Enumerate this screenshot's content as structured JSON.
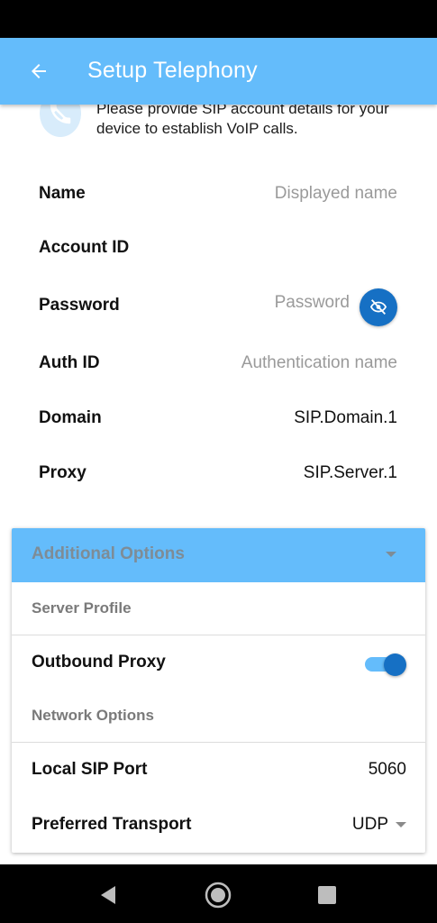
{
  "app_bar": {
    "title": "Setup Telephony",
    "back_icon": "arrow-left-icon"
  },
  "intro": {
    "icon": "phone-disabled-icon",
    "text": "Please provide SIP account details for your device to establish VoIP calls."
  },
  "fields": {
    "name": {
      "label": "Name",
      "placeholder": "Displayed name"
    },
    "account_id": {
      "label": "Account ID",
      "value": ""
    },
    "password": {
      "label": "Password",
      "placeholder": "Password",
      "toggle_icon": "eye-off-icon"
    },
    "auth_id": {
      "label": "Auth ID",
      "placeholder": "Authentication name"
    },
    "domain": {
      "label": "Domain",
      "value": "SIP.Domain.1"
    },
    "proxy": {
      "label": "Proxy",
      "value": "SIP.Server.1"
    }
  },
  "additional_options": {
    "title": "Additional Options",
    "server_profile_label": "Server Profile",
    "outbound_proxy": {
      "label": "Outbound Proxy",
      "enabled": true
    },
    "network_options_label": "Network Options",
    "local_sip_port": {
      "label": "Local SIP Port",
      "value": "5060"
    },
    "preferred_transport": {
      "label": "Preferred Transport",
      "value": "UDP"
    }
  },
  "colors": {
    "accent": "#64bcfb",
    "primary_dark": "#1670c4"
  },
  "nav": {
    "back_icon": "nav-back-icon",
    "home_icon": "nav-home-icon",
    "recents_icon": "nav-recents-icon"
  }
}
